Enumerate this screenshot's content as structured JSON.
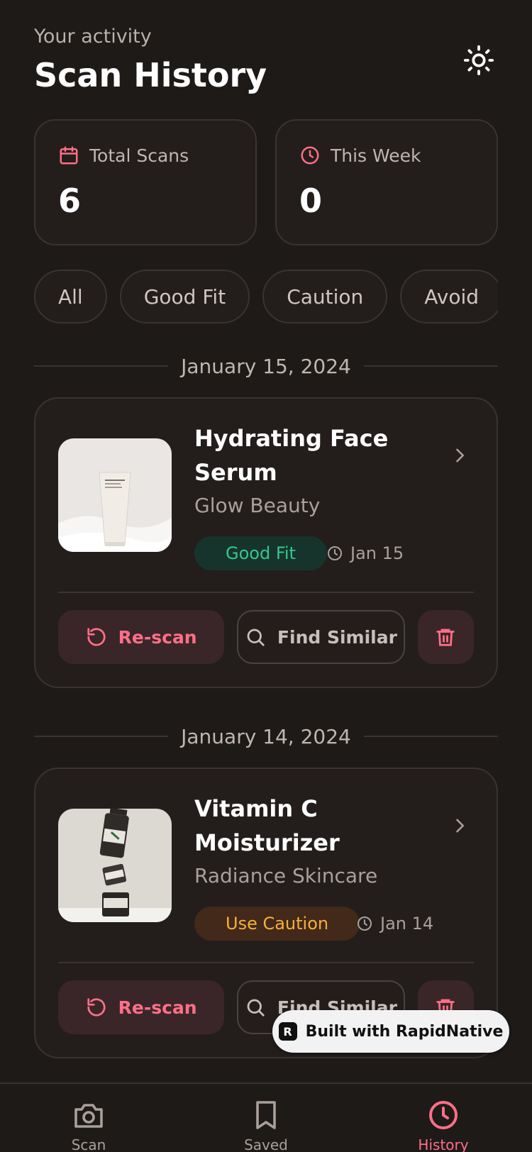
{
  "header": {
    "subtitle": "Your activity",
    "title": "Scan History",
    "theme_icon": "sun-icon"
  },
  "stats": [
    {
      "label": "Total Scans",
      "value": "6",
      "icon": "calendar-icon"
    },
    {
      "label": "This Week",
      "value": "0",
      "icon": "clock-icon"
    }
  ],
  "filters": [
    "All",
    "Good Fit",
    "Caution",
    "Avoid"
  ],
  "groups": [
    {
      "date_label": "January 15, 2024",
      "item": {
        "name": "Hydrating Face Serum",
        "brand": "Glow Beauty",
        "status": "Good Fit",
        "date": "Jan 15",
        "rescan_label": "Re-scan",
        "similar_label": "Find Similar"
      }
    },
    {
      "date_label": "January 14, 2024",
      "item": {
        "name": "Vitamin C Moisturizer",
        "brand": "Radiance Skincare",
        "status": "Use Caution",
        "date": "Jan 14",
        "rescan_label": "Re-scan",
        "similar_label": "Find Similar"
      }
    }
  ],
  "badge": {
    "label": "Built with RapidNative",
    "logo_text": "R"
  },
  "nav": [
    {
      "label": "Scan",
      "icon": "camera-icon"
    },
    {
      "label": "Saved",
      "icon": "bookmark-icon"
    },
    {
      "label": "History",
      "icon": "clock-icon"
    }
  ],
  "colors": {
    "accent": "#ff6f87",
    "good": "#34c78d",
    "caution": "#f5b03a",
    "background": "#1e1a18"
  }
}
